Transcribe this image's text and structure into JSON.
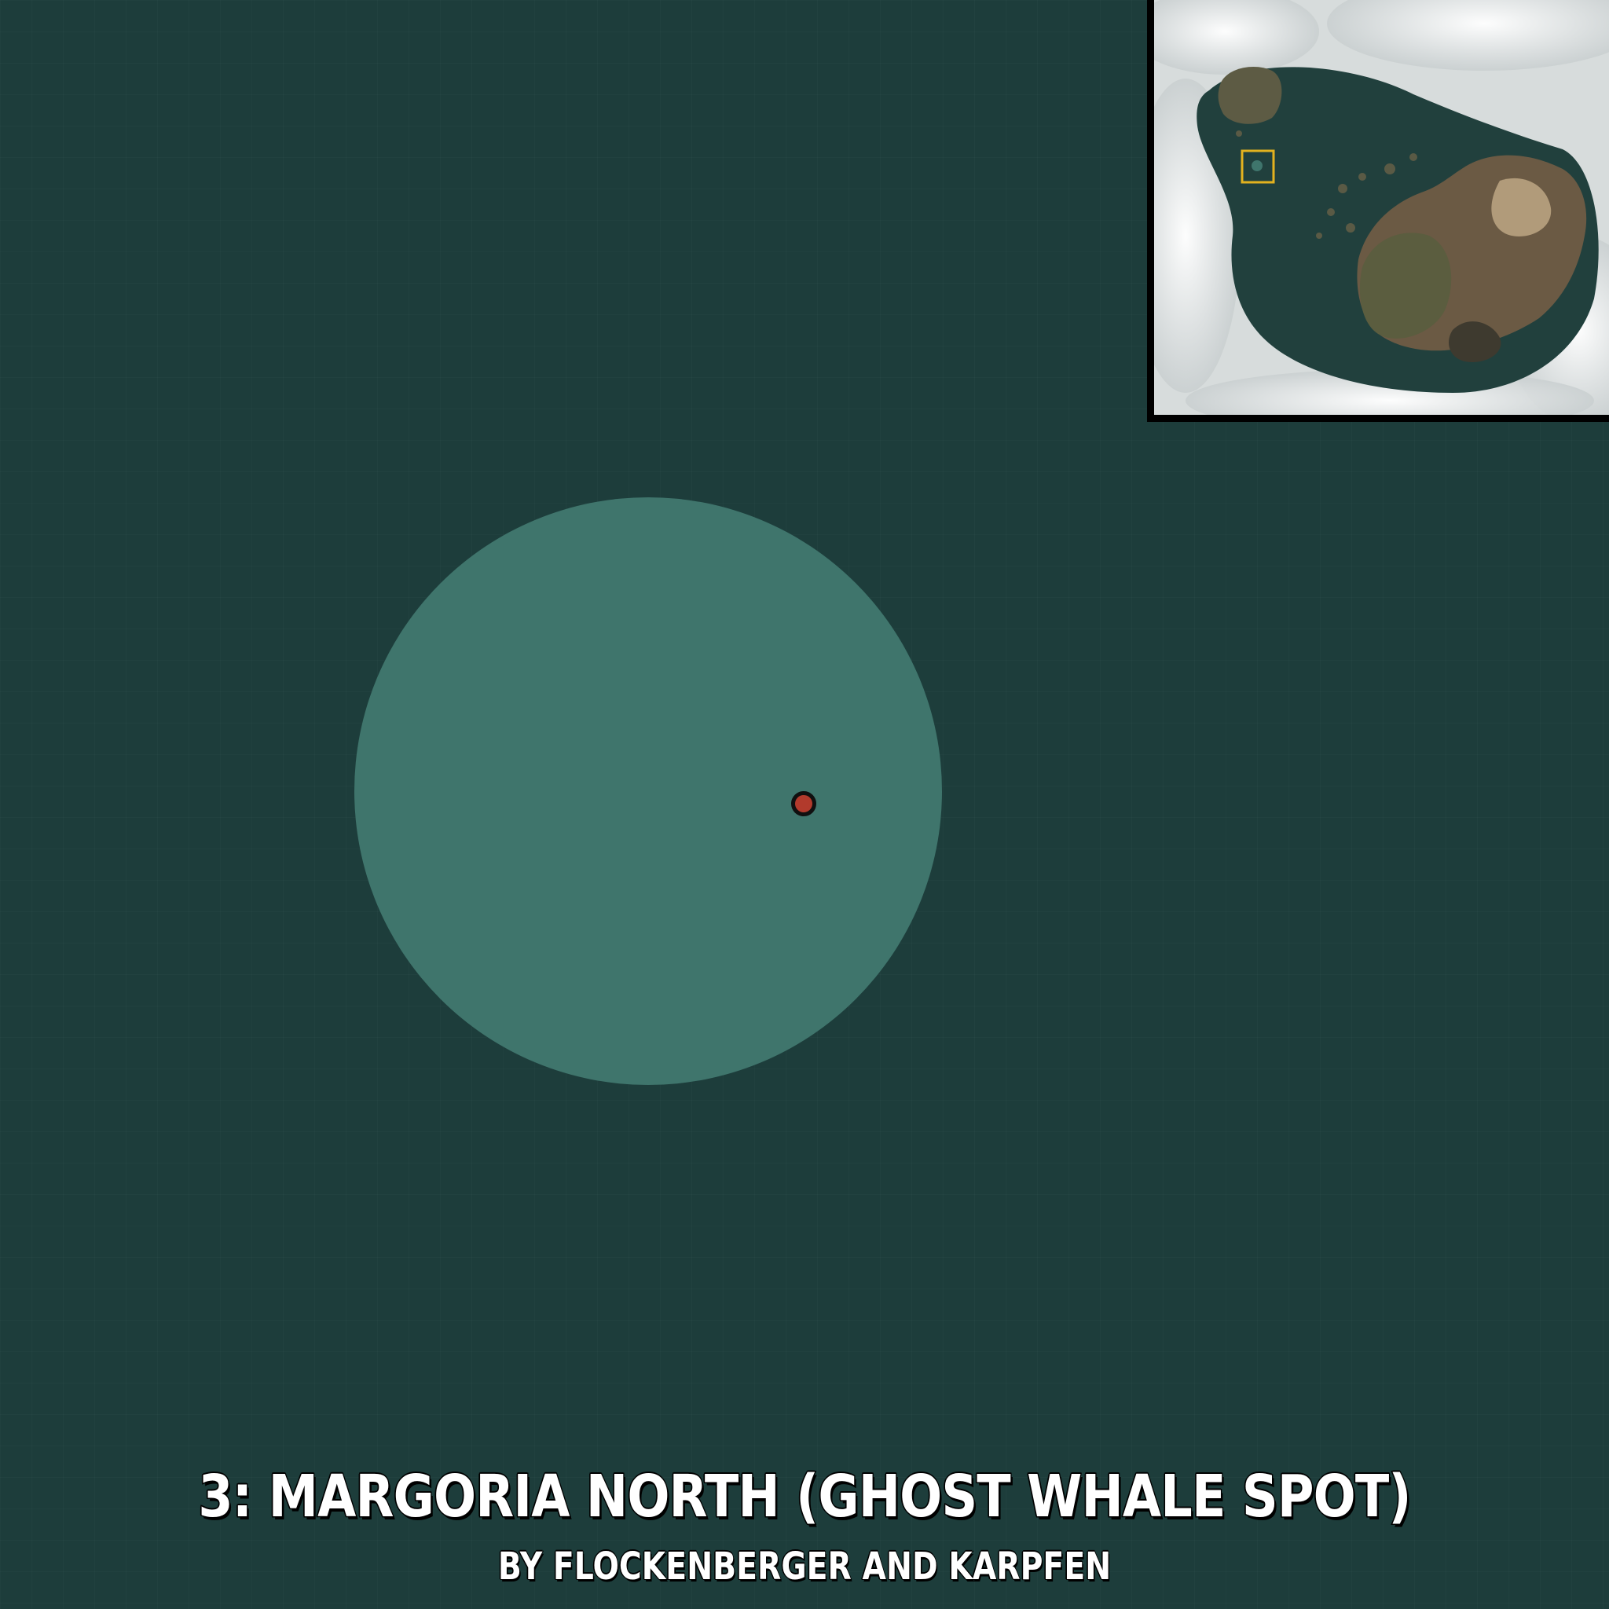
{
  "map": {
    "title": "3: MARGORIA NORTH (GHOST WHALE SPOT)",
    "credit": "BY FLOCKENBERGER AND KARPFEN",
    "icons": {
      "zone": "spawn-zone-circle",
      "marker": "location-marker-icon",
      "minimap": "overview-minimap",
      "locator": "location-highlight-box"
    },
    "colors": {
      "ocean": "#1d3d3b",
      "zone": "#3f756c",
      "marker": "#b23a2c",
      "locator": "#e3b21f",
      "text": "#ffffff"
    }
  }
}
